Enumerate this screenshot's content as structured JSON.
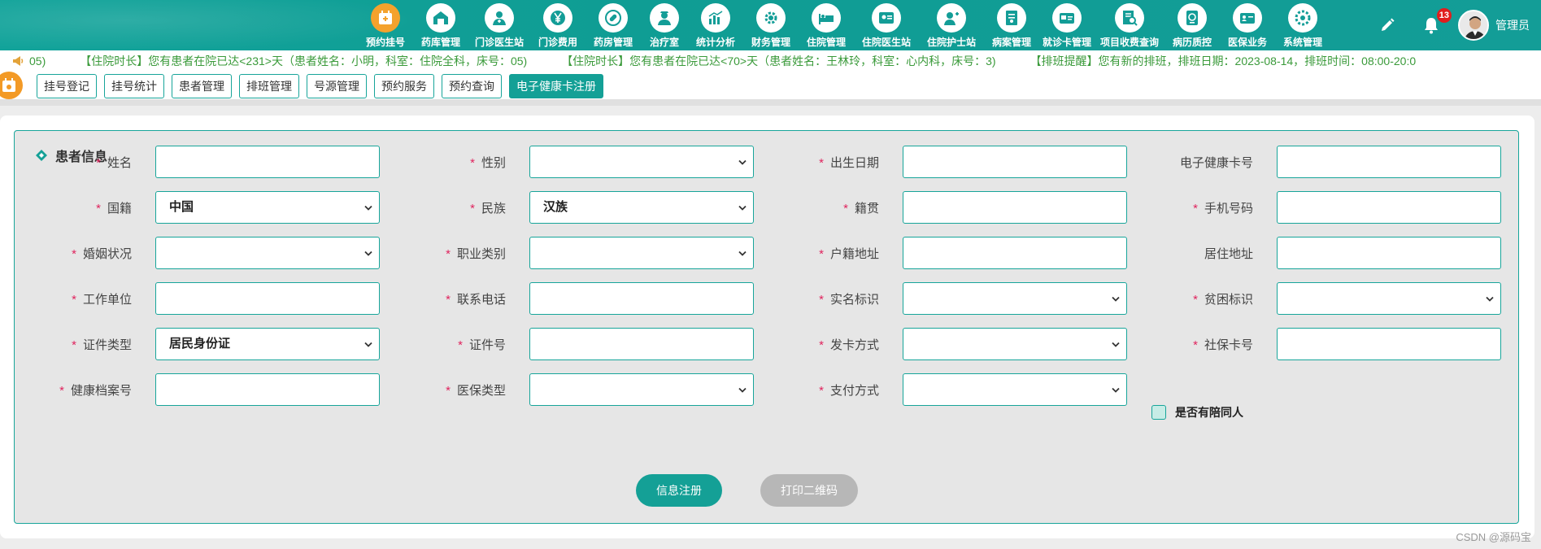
{
  "nav": {
    "items": [
      {
        "label": "预约挂号",
        "icon": "calendar-icon"
      },
      {
        "label": "药库管理",
        "icon": "warehouse-icon"
      },
      {
        "label": "门诊医生站",
        "icon": "doctor-icon"
      },
      {
        "label": "门诊费用",
        "icon": "yen-icon"
      },
      {
        "label": "药房管理",
        "icon": "pill-icon"
      },
      {
        "label": "治疗室",
        "icon": "nurse-icon"
      },
      {
        "label": "统计分析",
        "icon": "bar-chart-icon"
      },
      {
        "label": "财务管理",
        "icon": "finance-gear-icon"
      },
      {
        "label": "住院管理",
        "icon": "hospital-bed-icon"
      },
      {
        "label": "住院医生站",
        "icon": "inpatient-doctor-icon"
      },
      {
        "label": "住院护士站",
        "icon": "inpatient-nurse-icon"
      },
      {
        "label": "病案管理",
        "icon": "medical-record-icon"
      },
      {
        "label": "就诊卡管理",
        "icon": "card-icon"
      },
      {
        "label": "项目收费查询",
        "icon": "fee-search-icon"
      },
      {
        "label": "病历质控",
        "icon": "quality-control-icon"
      },
      {
        "label": "医保业务",
        "icon": "insurance-icon"
      },
      {
        "label": "系统管理",
        "icon": "settings-icon"
      }
    ],
    "active_index": 0,
    "notification_count": "13",
    "username": "管理员"
  },
  "marquee": {
    "messages": [
      "05)",
      "【住院时长】您有患者在院已达<231>天（患者姓名：小明，科室：住院全科，床号：05)",
      "【住院时长】您有患者在院已达<70>天（患者姓名：王林玲，科室：心内科，床号：3)",
      "【排班提醒】您有新的排班，排班日期：2023-08-14，排班时间：08:00-20:0"
    ]
  },
  "tabs": {
    "items": [
      "挂号登记",
      "挂号统计",
      "患者管理",
      "排班管理",
      "号源管理",
      "预约服务",
      "预约查询",
      "电子健康卡注册"
    ],
    "active_index": 7
  },
  "form": {
    "title": "患者信息",
    "fields": [
      {
        "label": "姓名",
        "required": true,
        "type": "input",
        "value": ""
      },
      {
        "label": "性别",
        "required": true,
        "type": "select",
        "value": ""
      },
      {
        "label": "出生日期",
        "required": true,
        "type": "input",
        "value": ""
      },
      {
        "label": "电子健康卡号",
        "required": false,
        "type": "input",
        "value": ""
      },
      {
        "label": "国籍",
        "required": true,
        "type": "select",
        "value": "中国"
      },
      {
        "label": "民族",
        "required": true,
        "type": "select",
        "value": "汉族"
      },
      {
        "label": "籍贯",
        "required": true,
        "type": "input",
        "value": ""
      },
      {
        "label": "手机号码",
        "required": true,
        "type": "input",
        "value": ""
      },
      {
        "label": "婚姻状况",
        "required": true,
        "type": "select",
        "value": ""
      },
      {
        "label": "职业类别",
        "required": true,
        "type": "select",
        "value": ""
      },
      {
        "label": "户籍地址",
        "required": true,
        "type": "input",
        "value": ""
      },
      {
        "label": "居住地址",
        "required": false,
        "type": "input",
        "value": ""
      },
      {
        "label": "工作单位",
        "required": true,
        "type": "input",
        "value": ""
      },
      {
        "label": "联系电话",
        "required": true,
        "type": "input",
        "value": ""
      },
      {
        "label": "实名标识",
        "required": true,
        "type": "select",
        "value": ""
      },
      {
        "label": "贫困标识",
        "required": true,
        "type": "select",
        "value": ""
      },
      {
        "label": "证件类型",
        "required": true,
        "type": "select",
        "value": "居民身份证"
      },
      {
        "label": "证件号",
        "required": true,
        "type": "input",
        "value": ""
      },
      {
        "label": "发卡方式",
        "required": true,
        "type": "select",
        "value": ""
      },
      {
        "label": "社保卡号",
        "required": true,
        "type": "input",
        "value": ""
      },
      {
        "label": "健康档案号",
        "required": true,
        "type": "input",
        "value": ""
      },
      {
        "label": "医保类型",
        "required": true,
        "type": "select",
        "value": ""
      },
      {
        "label": "支付方式",
        "required": true,
        "type": "select",
        "value": ""
      }
    ],
    "checkbox_label": "是否有陪同人",
    "submit_label": "信息注册",
    "print_label": "打印二维码"
  },
  "watermark": "CSDN @源码宝",
  "colors": {
    "primary": "#14a096",
    "accent": "#f4a22d",
    "required": "#e0245e",
    "badge": "#e11d1d",
    "marquee_text": "#3a9a3a"
  }
}
